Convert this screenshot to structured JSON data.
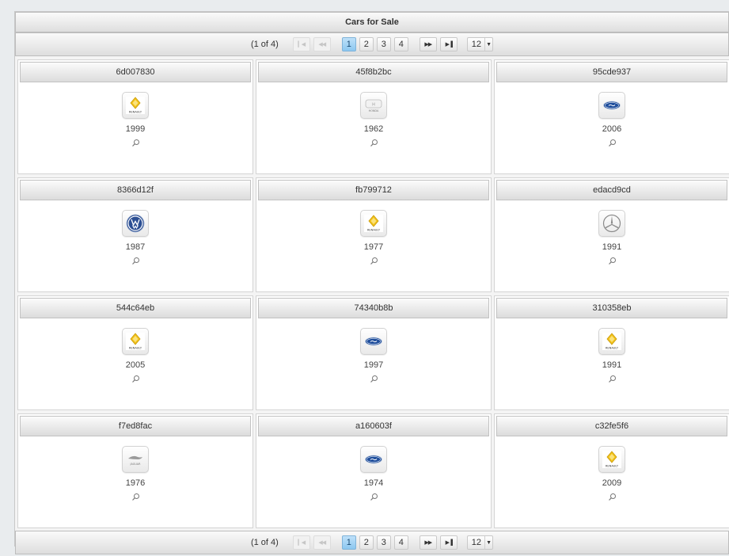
{
  "title": "Cars for Sale",
  "paginator": {
    "current_page_report": "(1 of 4)",
    "first_icon": "first-page-icon",
    "prev_icon": "previous-page-icon",
    "pages": [
      "1",
      "2",
      "3",
      "4"
    ],
    "active_page": "1",
    "next_icon": "next-page-icon",
    "last_icon": "last-page-icon",
    "rows_per_page": "12",
    "dropdown_icon": "chevron-down-icon"
  },
  "cars": [
    {
      "id": "6d007830",
      "year": "1999",
      "brand": "renault"
    },
    {
      "id": "45f8b2bc",
      "year": "1962",
      "brand": "honda"
    },
    {
      "id": "95cde937",
      "year": "2006",
      "brand": "ford"
    },
    {
      "id": "8366d12f",
      "year": "1987",
      "brand": "volkswagen"
    },
    {
      "id": "fb799712",
      "year": "1977",
      "brand": "renault"
    },
    {
      "id": "edacd9cd",
      "year": "1991",
      "brand": "mercedes"
    },
    {
      "id": "544c64eb",
      "year": "2005",
      "brand": "renault"
    },
    {
      "id": "74340b8b",
      "year": "1997",
      "brand": "ford"
    },
    {
      "id": "310358eb",
      "year": "1991",
      "brand": "renault"
    },
    {
      "id": "f7ed8fac",
      "year": "1976",
      "brand": "jaguar"
    },
    {
      "id": "a160603f",
      "year": "1974",
      "brand": "ford"
    },
    {
      "id": "c32fe5f6",
      "year": "2009",
      "brand": "renault"
    }
  ],
  "logo_texts": {
    "renault": "RENAULT",
    "honda": "HONDA",
    "jaguar": "JAGUAR"
  },
  "colors": {
    "active_page": "#8cc7f0",
    "ford_blue": "#1f4e9c",
    "renault_yellow": "#f2c21a"
  },
  "zoom_icon": "magnifier-icon"
}
